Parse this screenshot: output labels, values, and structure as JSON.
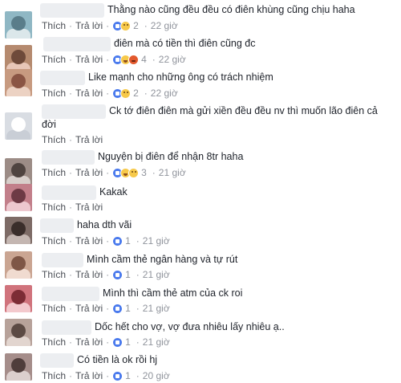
{
  "comments": [
    {
      "text": "Thằng nào cũng đều đều có điên khùng cũng chịu haha",
      "actions": {
        "like": "Thích",
        "reply": "Trả lời"
      },
      "reactions": [
        "like",
        "sad"
      ],
      "reaction_count": "2",
      "time": "22 giờ",
      "avatar_colors": [
        "#8fb7c4",
        "#5a7d8a",
        "#dbe7ea"
      ]
    },
    {
      "text": "điên mà có tiền thì điên cũng đc",
      "actions": {
        "like": "Thích",
        "reply": "Trả lời"
      },
      "reactions": [
        "like",
        "haha",
        "angry"
      ],
      "reaction_count": "4",
      "time": "22 giờ",
      "avatar_colors": [
        "#b58a6f",
        "#6e4a3a",
        "#e8c7b8"
      ]
    },
    {
      "text": "Like mạnh cho những ông có trách nhiệm",
      "actions": {
        "like": "Thích",
        "reply": "Trả lời"
      },
      "reactions": [
        "like",
        "sad"
      ],
      "reaction_count": "2",
      "time": "22 giờ",
      "avatar_colors": [
        "#c79a80",
        "#8a5544",
        "#ecd2c3"
      ]
    },
    {
      "text": "Ck tớ điên điên mà gửi xiền đều đều nv thì muốn lão điên cả đời",
      "actions": {
        "like": "Thích",
        "reply": "Trả lời"
      },
      "reactions": [],
      "reaction_count": "",
      "time": "",
      "avatar_colors": [
        "#d9dde3",
        "#ffffff",
        "#c9ced6"
      ]
    },
    {
      "text": "Nguyện bị điên để nhận 8tr haha",
      "actions": {
        "like": "Thích",
        "reply": "Trả lời"
      },
      "reactions": [
        "like",
        "haha",
        "sad"
      ],
      "reaction_count": "3",
      "time": "21 giờ",
      "avatar_colors": [
        "#9c8c86",
        "#4f4440",
        "#d8cfcb"
      ]
    },
    {
      "text": "Kakak",
      "actions": {
        "like": "Thích",
        "reply": "Trả lời"
      },
      "reactions": [],
      "reaction_count": "",
      "time": "",
      "avatar_colors": [
        "#c27f8a",
        "#6d3a45",
        "#edc8cf"
      ]
    },
    {
      "text": "haha dth vãi",
      "actions": {
        "like": "Thích",
        "reply": "Trả lời"
      },
      "reactions": [
        "like"
      ],
      "reaction_count": "1",
      "time": "21 giờ",
      "avatar_colors": [
        "#7d6b66",
        "#3a2e2b",
        "#c4b6b1"
      ]
    },
    {
      "text": "Mình cầm thẻ ngân hàng và tự rút",
      "actions": {
        "like": "Thích",
        "reply": "Trả lời"
      },
      "reactions": [
        "like"
      ],
      "reaction_count": "1",
      "time": "21 giờ",
      "avatar_colors": [
        "#caa592",
        "#7e5646",
        "#f0dbd0"
      ]
    },
    {
      "text": "Mình thì cầm thẻ atm của ck roi",
      "actions": {
        "like": "Thích",
        "reply": "Trả lời"
      },
      "reactions": [
        "like"
      ],
      "reaction_count": "1",
      "time": "21 giờ",
      "avatar_colors": [
        "#d0737c",
        "#7d2c35",
        "#f3c9cd"
      ]
    },
    {
      "text": "Dốc hết cho vợ, vợ đưa nhiêu lấy nhiêu ạ..",
      "actions": {
        "like": "Thích",
        "reply": "Trả lời"
      },
      "reactions": [
        "like"
      ],
      "reaction_count": "1",
      "time": "21 giờ",
      "avatar_colors": [
        "#b7a29a",
        "#5c4a44",
        "#e2d5cf"
      ]
    },
    {
      "text": "Có tiền là ok rồi hj",
      "actions": {
        "like": "Thích",
        "reply": "Trả lời"
      },
      "reactions": [
        "like"
      ],
      "reaction_count": "1",
      "time": "20 giờ",
      "avatar_colors": [
        "#a58d8a",
        "#4f3d3b",
        "#dccfcd"
      ]
    }
  ]
}
